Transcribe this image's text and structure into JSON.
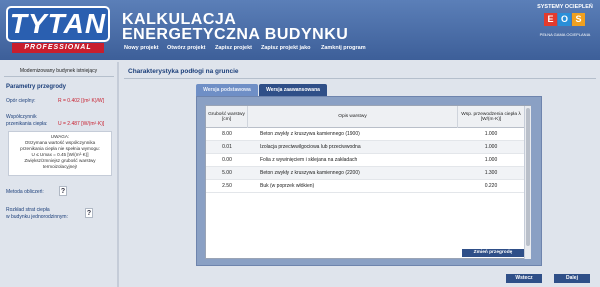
{
  "header": {
    "logo_main": "TYTAN",
    "logo_sub": "PROFESSIONAL",
    "title_line1": "KALKULACJA",
    "title_line2": "ENERGETYCZNA BUDYNKU",
    "brand_title": "SYSTEMY OCIEPLEŃ",
    "brand_letters": [
      "E",
      "O",
      "S"
    ],
    "brand_sub": "PEŁNA GAMA OCIEPLANIA"
  },
  "nav": [
    "Nowy projekt",
    "Otwórz projekt",
    "Zapisz projekt",
    "Zapisz projekt jako",
    "Zamknij program"
  ],
  "left": {
    "header": "Modernizowany budynek istniejący",
    "section_title": "Parametry przegrody",
    "opor_label": "Opór cieplny:",
    "opor_value": "R = 0.402 [(m² K)/W]",
    "wsp_label_1": "Współczynnik",
    "wsp_label_2": "przenikania ciepła:",
    "wsp_value": "U = 2.487 [W/(m²·K)]",
    "note_lines": [
      "UWAGA:",
      "Otrzymana wartość współczynnika",
      "przenikania ciepła nie spełnia wymogu:",
      "U ≤ Umax = 0.45 [W/(m²·K)]",
      "Zwiększ/zmniejsz grubość warstwy",
      "termoizolacyjnej!"
    ],
    "metoda_label": "Metoda obliczeń:",
    "rozklad_line1": "Rozkład strat ciepła",
    "rozklad_line2": "w budynku jednorodzinnym:",
    "help_glyph": "?"
  },
  "main": {
    "title": "Charakterystyka podłogi na gruncie",
    "tabs": [
      "Wersja podstawowa",
      "Wersja zaawansowana"
    ],
    "columns": [
      "Grubość warstwy [cm]",
      "Opis warstwy",
      "Wsp. przewodzenia ciepła λ [W/(m·K)]"
    ],
    "rows": [
      {
        "thickness": "8.00",
        "desc": "Beton zwykły z kruszywa kamiennego (1900)",
        "lambda": "1.000"
      },
      {
        "thickness": "0.01",
        "desc": "Izolacja przeciwwilgociowa lub przeciwwodna",
        "lambda": "1.000"
      },
      {
        "thickness": "0.00",
        "desc": "Folia z wywinięciem i sklejana na zakładach",
        "lambda": "1.000"
      },
      {
        "thickness": "5.00",
        "desc": "Beton zwykły z kruszywa kamiennego (2200)",
        "lambda": "1.300"
      },
      {
        "thickness": "2.50",
        "desc": "Buk (w poprzek włókien)",
        "lambda": "0.220"
      }
    ],
    "change_button": "Zmień przegrodę",
    "back_button": "Wstecz",
    "next_button": "Dalej"
  },
  "colors": {
    "header": "#3d5f99",
    "accent": "#2f4f88",
    "warning": "#c81e2d"
  }
}
